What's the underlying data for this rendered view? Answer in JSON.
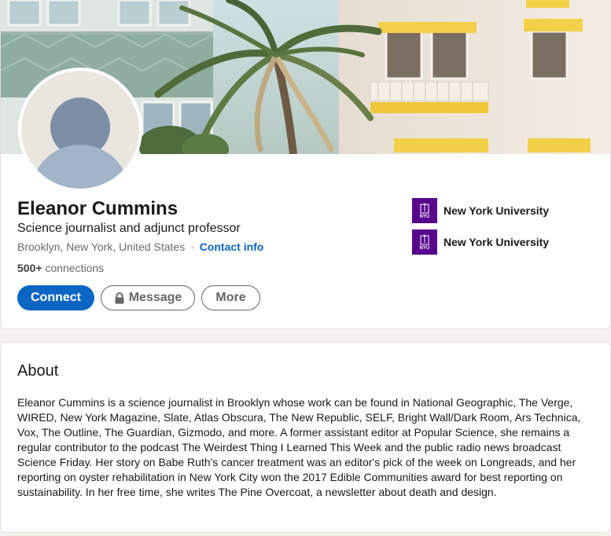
{
  "profile": {
    "name": "Eleanor Cummins",
    "headline": "Science journalist and adjunct professor",
    "location": "Brooklyn, New York, United States",
    "separator": "·",
    "contact_info_label": "Contact info",
    "connections_count": "500+",
    "connections_label": "connections"
  },
  "actions": {
    "connect_label": "Connect",
    "message_label": "Message",
    "more_label": "More"
  },
  "education": [
    {
      "school": "New York University",
      "logo_text": "NYU",
      "icon": "nyu-logo-icon"
    },
    {
      "school": "New York University",
      "logo_text": "NYU",
      "icon": "nyu-logo-icon"
    }
  ],
  "about": {
    "title": "About",
    "text": "Eleanor Cummins is a science journalist in Brooklyn whose work can be found in National Geographic, The Verge, WIRED, New York Magazine, Slate, Atlas Obscura, The New Republic, SELF, Bright Wall/Dark Room, Ars Technica, Vox, The Outline, The Guardian, Gizmodo, and more. A former assistant editor at Popular Science, she remains a regular contributor to the podcast The Weirdest Thing I Learned This Week and the public radio news broadcast Science Friday. Her story on Babe Ruth's cancer treatment was an editor's pick of the week on Longreads, and her reporting on oyster rehabilitation in New York City won the 2017 Edible Communities award for best reporting on sustainability. In her free time, she writes The Pine Overcoat, a newsletter about death and design."
  },
  "colors": {
    "accent": "#0a66c2",
    "nyu_purple": "#57068c",
    "page_bg": "#f3f2ef"
  }
}
